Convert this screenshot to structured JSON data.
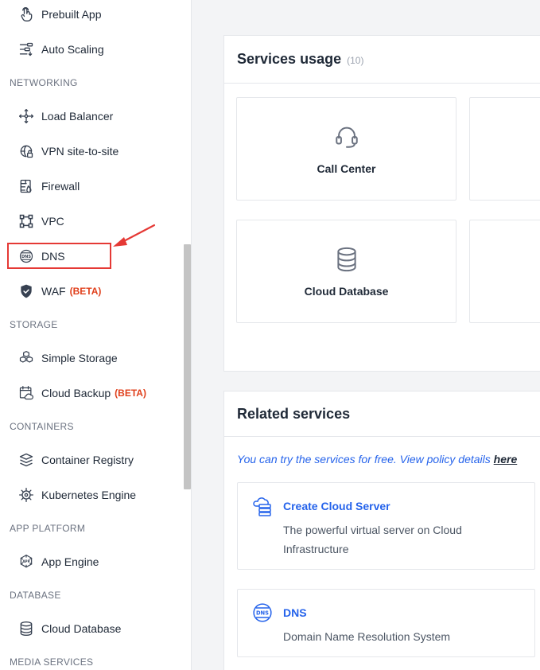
{
  "sidebar": {
    "items": [
      {
        "label": "Prebuilt App",
        "icon": "touch-icon"
      },
      {
        "label": "Auto Scaling",
        "icon": "auto-scaling-icon"
      },
      {
        "label": "Load Balancer",
        "icon": "load-balancer-icon"
      },
      {
        "label": "VPN site-to-site",
        "icon": "vpn-lock-icon"
      },
      {
        "label": "Firewall",
        "icon": "firewall-icon"
      },
      {
        "label": "VPC",
        "icon": "vpc-icon"
      },
      {
        "label": "DNS",
        "icon": "dns-globe-icon"
      },
      {
        "label": "WAF",
        "badge": "(BETA)",
        "icon": "shield-icon"
      },
      {
        "label": "Simple Storage",
        "icon": "cubes-icon"
      },
      {
        "label": "Cloud Backup",
        "badge": "(BETA)",
        "icon": "cloud-backup-icon"
      },
      {
        "label": "Container Registry",
        "icon": "layers-icon"
      },
      {
        "label": "Kubernetes Engine",
        "icon": "helm-icon"
      },
      {
        "label": "App Engine",
        "icon": "app-engine-icon"
      },
      {
        "label": "Cloud Database",
        "icon": "database-icon"
      }
    ],
    "sections": {
      "networking": "NETWORKING",
      "storage": "STORAGE",
      "containers": "CONTAINERS",
      "app_platform": "APP PLATFORM",
      "database": "DATABASE",
      "media_services": "MEDIA SERVICES"
    }
  },
  "usage": {
    "title": "Services usage",
    "count": "(10)",
    "tiles": [
      {
        "label": "Call Center",
        "icon": "headset-icon"
      },
      {
        "label": "Cloud Database",
        "icon": "database-icon"
      }
    ]
  },
  "related": {
    "title": "Related services",
    "policy_text": "You can try the services for free. View policy details ",
    "policy_link": "here",
    "services": [
      {
        "title": "Create Cloud Server",
        "desc": "The powerful virtual server on Cloud Infrastructure",
        "icon": "cloud-server-icon"
      },
      {
        "title": "DNS",
        "desc": "Domain Name Resolution System",
        "icon": "dns-globe-icon"
      }
    ]
  },
  "colors": {
    "accent": "#2563eb",
    "beta": "#e0401c",
    "highlight": "#e53935"
  }
}
